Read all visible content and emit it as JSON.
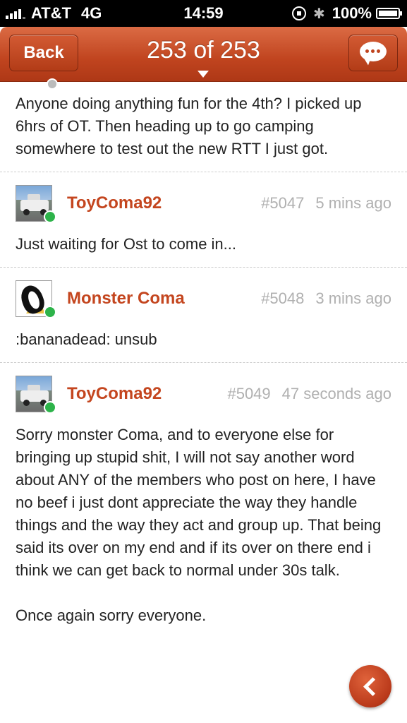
{
  "status_bar": {
    "carrier": "AT&T",
    "network": "4G",
    "time": "14:59",
    "battery": "100%"
  },
  "nav": {
    "back_label": "Back",
    "title": "253 of 253",
    "compose_icon": "chat-bubble-icon"
  },
  "posts": [
    {
      "text": "Anyone doing anything fun for the 4th?   I picked up 6hrs of OT.  Then heading up to go camping somewhere to test out the new RTT I just got."
    },
    {
      "username": "ToyComa92",
      "post_number": "#5047",
      "time_ago": "5 mins ago",
      "avatar": "truck",
      "online": true,
      "text": "Just waiting for Ost to come in..."
    },
    {
      "username": "Monster Coma",
      "post_number": "#5048",
      "time_ago": "3 mins ago",
      "avatar": "penguin",
      "online": true,
      "text": ":bananadead: unsub"
    },
    {
      "username": "ToyComa92",
      "post_number": "#5049",
      "time_ago": "47 seconds ago",
      "avatar": "truck",
      "online": true,
      "text": "Sorry monster Coma, and to everyone else for bringing up stupid shit, I will not say another word about ANY of the members who post on here, I have no beef i just dont appreciate the way they handle things and the way they act and group up. That being said its over on my end and if its over on there end i think we can get back to normal under 30s talk.\n\nOnce again sorry everyone."
    }
  ],
  "colors": {
    "accent": "#c4461f",
    "online": "#2db34a",
    "meta": "#b0b0b0"
  }
}
